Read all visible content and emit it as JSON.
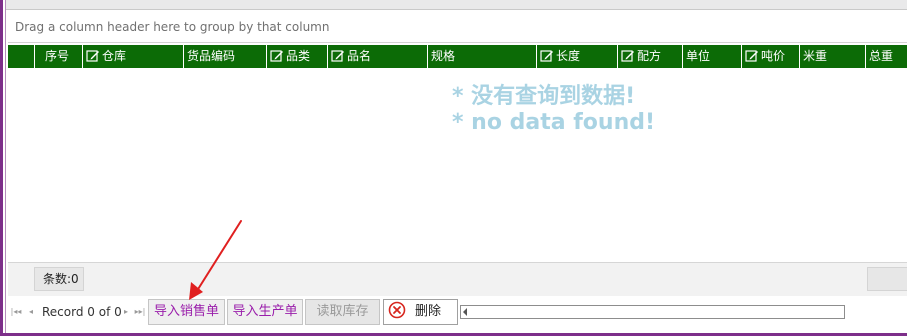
{
  "group_panel": {
    "hint": "Drag a column header here to group by that column"
  },
  "columns": [
    {
      "label": "序号",
      "editable": false
    },
    {
      "label": "仓库",
      "editable": true
    },
    {
      "label": "货品编码",
      "editable": false
    },
    {
      "label": "品类",
      "editable": true
    },
    {
      "label": "品名",
      "editable": true
    },
    {
      "label": "规格",
      "editable": false
    },
    {
      "label": "长度",
      "editable": true
    },
    {
      "label": "配方",
      "editable": true
    },
    {
      "label": "单位",
      "editable": false
    },
    {
      "label": "吨价",
      "editable": true
    },
    {
      "label": "米重",
      "editable": false
    },
    {
      "label": "总重",
      "editable": false
    }
  ],
  "empty_state": {
    "line1": "* 没有查询到数据!",
    "line2": "* no data found!"
  },
  "footer": {
    "count_label": "条数:0"
  },
  "navigator": {
    "record_text": "Record 0 of 0",
    "first_icon": "first-page-icon",
    "prev_icon": "prev-icon",
    "next_icon": "next-icon",
    "last_icon": "last-page-icon"
  },
  "buttons": {
    "import_sales": "导入销售单",
    "import_production": "导入生产单",
    "read_stock": "读取库存",
    "delete": "删除"
  },
  "colors": {
    "header_bg": "#0c6b06",
    "frame_purple": "#7d2f8a",
    "import_text": "#9a1eab",
    "empty_state_text": "#a9d3e3",
    "annotation_arrow": "#e02020"
  }
}
